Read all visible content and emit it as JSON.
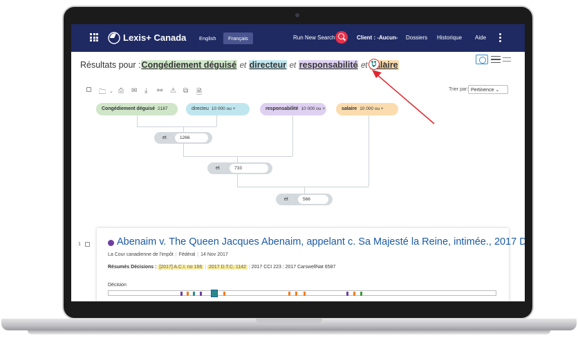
{
  "colors": {
    "header_bg": "#1f2a63",
    "term_1": "#cfe6c9",
    "term_2": "#bfe6ee",
    "term_3": "#ddd0f0",
    "term_4": "#fbdcae",
    "link": "#1a5aa8",
    "annotation_arrow": "#e0262e"
  },
  "header": {
    "brand": "Lexis+ Canada",
    "lang_en": "English",
    "lang_fr": "Français",
    "run_new_search": "Run New Search",
    "client": "Client : -Aucun-",
    "dossiers": "Dossiers",
    "historique": "Historique",
    "aide": "Aide"
  },
  "query": {
    "prefix": "Résultats pour :",
    "terms": [
      "Congédiement déguisé",
      "directeur",
      "responsabilité",
      "salaire"
    ],
    "connector": "et"
  },
  "toolbar": {
    "sort_label": "Trier par:",
    "sort_value": "Pertinence"
  },
  "tree": {
    "terms": [
      {
        "label": "Congédiement déguisé",
        "count": "2187"
      },
      {
        "label": "directeu",
        "count": "10 000 ou +"
      },
      {
        "label": "responsabilité",
        "count": "10 000 ou +"
      },
      {
        "label": "salaire",
        "count": "10 000 ou +"
      }
    ],
    "operators": [
      {
        "label": "et",
        "count": "1266"
      },
      {
        "label": "et",
        "count": "733"
      },
      {
        "label": "et",
        "count": "566"
      }
    ]
  },
  "result": {
    "number": "1",
    "title": "Abenaim v. The Queen Jacques Abenaim, appelant c. Sa Majesté la Reine, intimée., 2017 DTC 1142",
    "court": "La Cour canadienne de l'impôt",
    "jurisdiction": "Fédéral",
    "date": "14 Nov 2017",
    "cites_label": "Résumés Décisions :",
    "cites": [
      "[2017] A.C.I. no 166",
      "2017 D.T.C. 1142",
      "2017 CCI 223",
      "2017 CarswellNat 6587"
    ],
    "decision_label": "Décision"
  }
}
